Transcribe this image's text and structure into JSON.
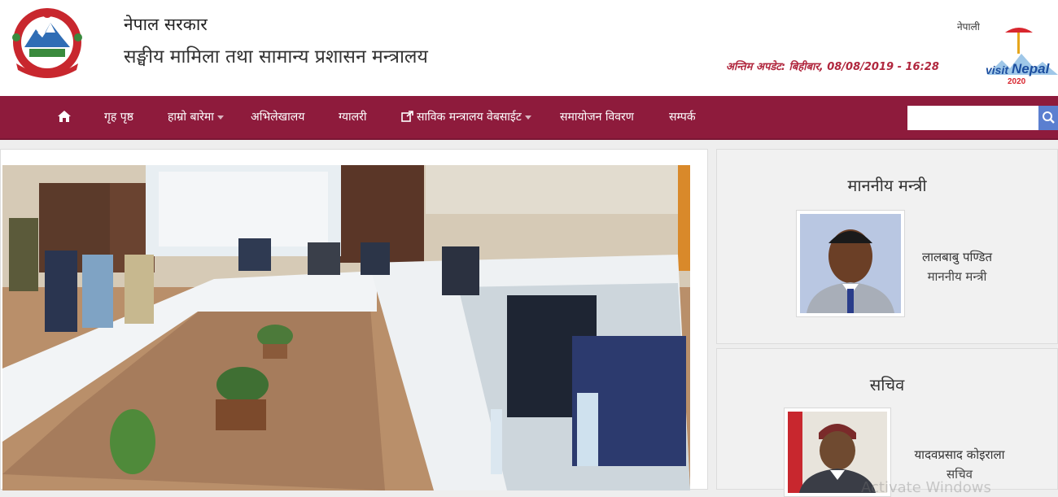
{
  "header": {
    "government": "नेपाल सरकार",
    "ministry": "सङ्घीय मामिला तथा सामान्य प्रशासन मन्त्रालय",
    "language_link": "नेपाली",
    "last_update": "अन्तिम अपडेट: बिहीबार, 08/08/2019 - 16:28",
    "visit_logo": {
      "line1": "visit",
      "line2": "Nepal",
      "year": "2020"
    }
  },
  "nav": {
    "home_icon": "home-icon",
    "items": [
      {
        "label": "गृह पृष्ठ",
        "dropdown": false
      },
      {
        "label": "हाम्रो बारेमा",
        "dropdown": true
      },
      {
        "label": "अभिलेखालय",
        "dropdown": false
      },
      {
        "label": "ग्यालरी",
        "dropdown": false
      },
      {
        "label": "साविक मन्त्रालय वेबसाईट",
        "dropdown": true,
        "icon": "external-link-icon"
      },
      {
        "label": "समायोजन विवरण",
        "dropdown": false
      },
      {
        "label": "सम्पर्क",
        "dropdown": false
      }
    ],
    "search_placeholder": "",
    "search_icon": "search-icon"
  },
  "sidebar": {
    "minister": {
      "title": "माननीय मन्त्री",
      "name": "लालबाबु पण्डित",
      "role": "माननीय मन्त्री"
    },
    "secretary": {
      "title": "सचिव",
      "name": "यादवप्रसाद कोइराला",
      "role": "सचिव"
    }
  },
  "watermark": "Activate Windows",
  "colors": {
    "nav_bg": "#8e1b3c",
    "update_text": "#b0263d",
    "search_button": "#5b7fd0"
  }
}
